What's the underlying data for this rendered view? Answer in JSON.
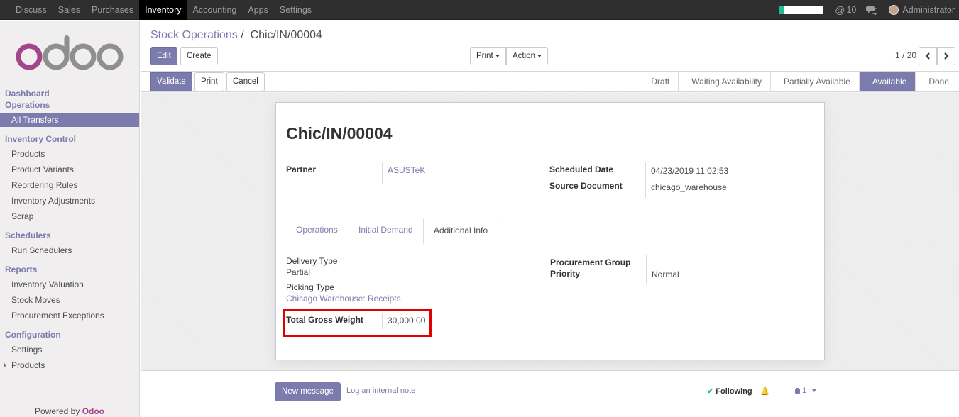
{
  "topbar": {
    "menu": [
      "Discuss",
      "Sales",
      "Purchases",
      "Inventory",
      "Accounting",
      "Apps",
      "Settings"
    ],
    "active_menu": "Inventory",
    "progress": 0.1,
    "mentions_count": "10",
    "user": "Administrator"
  },
  "sidebar": {
    "logo_text": "odoo",
    "sections": {
      "dashboard": "Dashboard",
      "operations": "Operations",
      "inventory_control": "Inventory Control",
      "schedulers": "Schedulers",
      "reports": "Reports",
      "configuration": "Configuration"
    },
    "items": {
      "all_transfers": "All Transfers",
      "products": "Products",
      "product_variants": "Product Variants",
      "reordering_rules": "Reordering Rules",
      "inventory_adjustments": "Inventory Adjustments",
      "scrap": "Scrap",
      "run_schedulers": "Run Schedulers",
      "inventory_valuation": "Inventory Valuation",
      "stock_moves": "Stock Moves",
      "procurement_exceptions": "Procurement Exceptions",
      "settings": "Settings",
      "config_products": "Products"
    },
    "powered_prefix": "Powered by",
    "powered_brand": "Odoo"
  },
  "control_panel": {
    "breadcrumb_parent": "Stock Operations",
    "breadcrumb_sep": "/",
    "breadcrumb_current": "Chic/IN/00004",
    "edit": "Edit",
    "create": "Create",
    "print": "Print",
    "action": "Action",
    "pager": "1 / 20"
  },
  "statusbar": {
    "validate": "Validate",
    "print": "Print",
    "cancel": "Cancel",
    "stages": [
      "Draft",
      "Waiting Availability",
      "Partially Available",
      "Available",
      "Done"
    ],
    "current_stage": "Available"
  },
  "form": {
    "title": "Chic/IN/00004",
    "partner_label": "Partner",
    "partner_value": "ASUSTeK",
    "scheduled_date_label": "Scheduled Date",
    "scheduled_date_value": "04/23/2019 11:02:53",
    "source_document_label": "Source Document",
    "source_document_value": "chicago_warehouse",
    "tabs": [
      "Operations",
      "Initial Demand",
      "Additional Info"
    ],
    "active_tab": "Additional Info",
    "delivery_type_label": "Delivery Type",
    "delivery_type_value": "Partial",
    "picking_type_label": "Picking Type",
    "picking_type_value": "Chicago Warehouse: Receipts",
    "procurement_group_label": "Procurement Group",
    "priority_label": "Priority",
    "priority_value": "Normal",
    "total_gross_weight_label": "Total Gross Weight",
    "total_gross_weight_value": "30,000.00"
  },
  "chatter": {
    "new_message": "New message",
    "log_note": "Log an internal note",
    "following": "Following",
    "followers_count": "1"
  },
  "colors": {
    "accent": "#7c7bad",
    "brand": "#a24689",
    "highlight": "#e00000"
  }
}
